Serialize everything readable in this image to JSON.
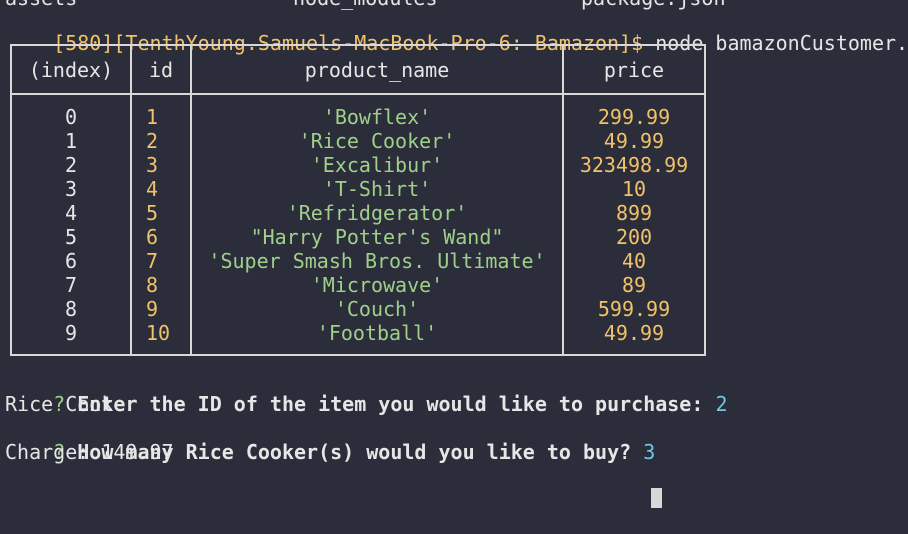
{
  "terminal": {
    "top_partial": [
      "assets",
      "node_modules",
      "package.json"
    ],
    "prompt_prefix": "[580][TenthYoung.Samuels-MacBook-Pro-6: Bamazon]$",
    "command": " node bamazonCustomer.js"
  },
  "table": {
    "headers": [
      "(index)",
      "id",
      "product_name",
      "price"
    ],
    "rows": [
      {
        "index": "0",
        "id": "1",
        "product_name": "'Bowflex'",
        "price": "299.99"
      },
      {
        "index": "1",
        "id": "2",
        "product_name": "'Rice Cooker'",
        "price": "49.99"
      },
      {
        "index": "2",
        "id": "3",
        "product_name": "'Excalibur'",
        "price": "323498.99"
      },
      {
        "index": "3",
        "id": "4",
        "product_name": "'T-Shirt'",
        "price": "10"
      },
      {
        "index": "4",
        "id": "5",
        "product_name": "'Refridgerator'",
        "price": "899"
      },
      {
        "index": "5",
        "id": "6",
        "product_name": "\"Harry Potter's Wand\"",
        "price": "200"
      },
      {
        "index": "6",
        "id": "7",
        "product_name": "'Super Smash Bros. Ultimate'",
        "price": "40"
      },
      {
        "index": "7",
        "id": "8",
        "product_name": "'Microwave'",
        "price": "89"
      },
      {
        "index": "8",
        "id": "9",
        "product_name": "'Couch'",
        "price": "599.99"
      },
      {
        "index": "9",
        "id": "10",
        "product_name": "'Football'",
        "price": "49.99"
      }
    ]
  },
  "prompts": {
    "q_mark": "?",
    "q1_text": " Enter the ID of the item you would like to purchase:",
    "q1_answer": " 2",
    "selected_product": "Rice Cooker",
    "q2_text": " How many Rice Cooker(s) would you like to buy?",
    "q2_answer": " 3",
    "charge": "Charge: 149.97"
  }
}
